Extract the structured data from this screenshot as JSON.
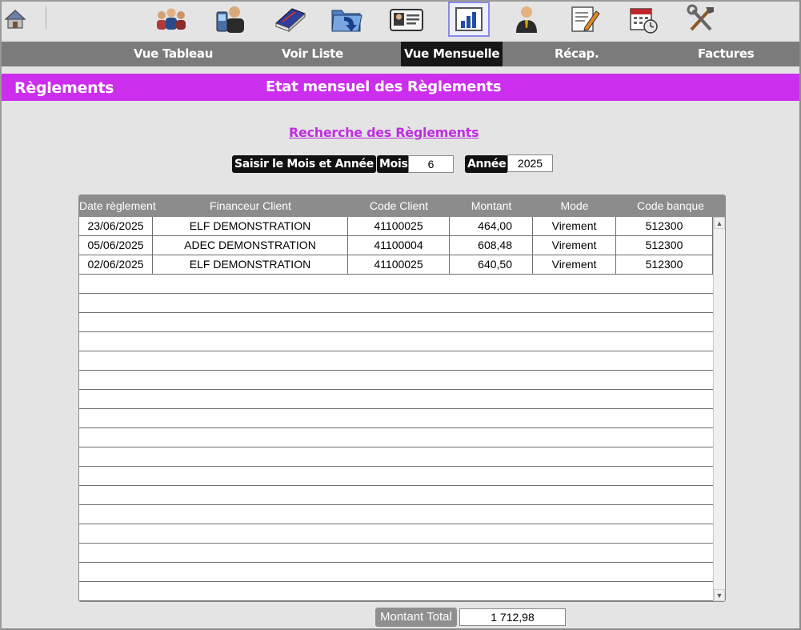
{
  "toolbar": {
    "icons": [
      "home-icon",
      "contacts-icon",
      "mobile-contact-icon",
      "book-icon",
      "folder-import-icon",
      "id-card-icon",
      "bar-chart-icon",
      "person-icon",
      "edit-document-icon",
      "calendar-clock-icon",
      "tools-icon"
    ],
    "active": "bar-chart-icon"
  },
  "nav": {
    "items": [
      {
        "label": "Vue Tableau"
      },
      {
        "label": "Voir Liste"
      },
      {
        "label": "Vue Mensuelle",
        "active": true
      },
      {
        "label": "Récap."
      },
      {
        "label": "Factures"
      }
    ]
  },
  "header": {
    "section": "Règlements",
    "title": "Etat mensuel des Règlements"
  },
  "search": {
    "link": "Recherche des Règlements",
    "prompt_label": "Saisir le Mois et Année",
    "month_label": "Mois",
    "month_value": "6",
    "year_label": "Année",
    "year_value": "2025"
  },
  "table": {
    "columns": [
      "Date règlement",
      "Financeur Client",
      "Code Client",
      "Montant",
      "Mode",
      "Code banque"
    ],
    "rows": [
      [
        "23/06/2025",
        "ELF DEMONSTRATION",
        "41100025",
        "464,00",
        "Virement",
        "512300"
      ],
      [
        "05/06/2025",
        "ADEC DEMONSTRATION",
        "41100004",
        "608,48",
        "Virement",
        "512300"
      ],
      [
        "02/06/2025",
        "ELF DEMONSTRATION",
        "41100025",
        "640,50",
        "Virement",
        "512300"
      ]
    ],
    "empty_rows": 17
  },
  "total": {
    "label": "Montant Total",
    "value": "1 712,98"
  },
  "colors": {
    "header_band": "#cc2eed",
    "link": "#bf2ee0",
    "nav_bar": "#7b7b7b",
    "nav_active": "#161616",
    "table_header": "#8c8c8c"
  }
}
